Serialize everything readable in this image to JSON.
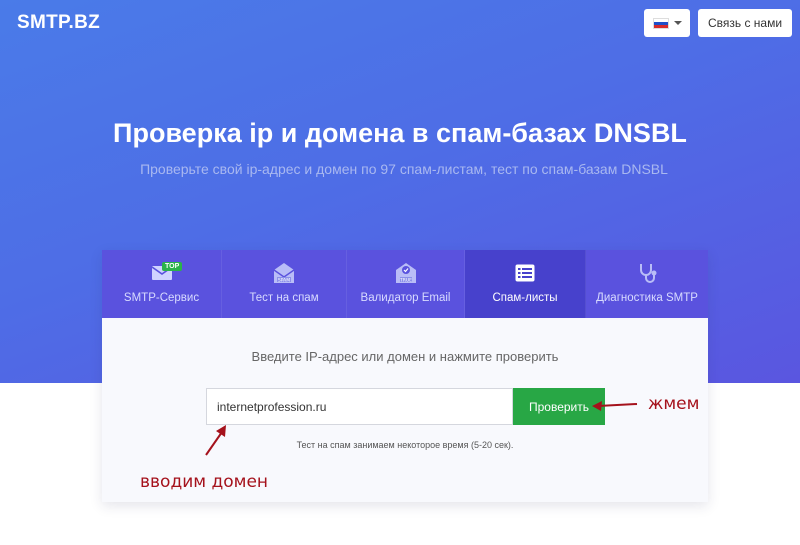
{
  "header": {
    "logo": "SMTP.BZ",
    "language_flag": "russia-flag-icon",
    "contact_label": "Связь с нами"
  },
  "hero": {
    "title": "Проверка ip и домена в спам-базах DNSBL",
    "subtitle": "Проверьте свой ip-адрес и домен по 97 спам-листам, тест по спам-базам DNSBL"
  },
  "tabs": [
    {
      "label": "SMTP-Сервис",
      "icon": "envelope-icon",
      "badge": "TOP",
      "active": false
    },
    {
      "label": "Тест на спам",
      "icon": "spam-envelope-icon",
      "active": false
    },
    {
      "label": "Валидатор Email",
      "icon": "true-envelope-icon",
      "active": false
    },
    {
      "label": "Спам-листы",
      "icon": "list-icon",
      "active": true
    },
    {
      "label": "Диагностика SMTP",
      "icon": "stethoscope-icon",
      "active": false
    }
  ],
  "form": {
    "prompt": "Введите IP-адрес или домен и нажмите проверить",
    "input_value": "internetprofession.ru",
    "button_label": "Проверить",
    "note": "Тест на спам занимаем некоторое время (5-20 сек)."
  },
  "annotations": {
    "press": "жмем",
    "enter_domain": "вводим домен"
  },
  "colors": {
    "hero_gradient_start": "#4a7be8",
    "hero_gradient_end": "#5a56e0",
    "tab_bar": "#5a52de",
    "tab_active": "#4741cc",
    "button": "#28a745",
    "annotation": "#a5121c"
  }
}
